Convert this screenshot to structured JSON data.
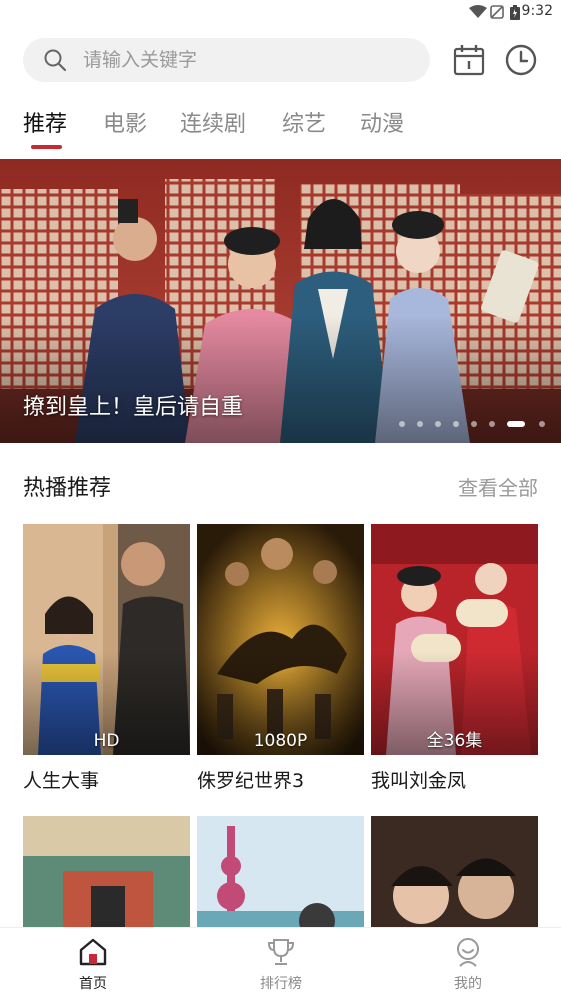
{
  "status_bar": {
    "time": "9:32"
  },
  "search": {
    "placeholder": "请输入关键字"
  },
  "header_icons": [
    "calendar-icon",
    "clock-icon"
  ],
  "tabs": [
    {
      "label": "推荐",
      "active": true
    },
    {
      "label": "电影",
      "active": false
    },
    {
      "label": "连续剧",
      "active": false
    },
    {
      "label": "综艺",
      "active": false
    },
    {
      "label": "动漫",
      "active": false
    }
  ],
  "banner": {
    "title": "撩到皇上！皇后请自重",
    "slide_count": 8,
    "active_slide": 7
  },
  "section": {
    "title": "热播推荐",
    "view_all": "查看全部"
  },
  "cards": [
    {
      "title": "人生大事",
      "badge": "HD"
    },
    {
      "title": "侏罗纪世界3",
      "badge": "1080P"
    },
    {
      "title": "我叫刘金凤",
      "badge": "全36集"
    }
  ],
  "bottom_nav": [
    {
      "label": "首页",
      "icon": "home-icon",
      "active": true
    },
    {
      "label": "排行榜",
      "icon": "trophy-icon",
      "active": false
    },
    {
      "label": "我的",
      "icon": "profile-icon",
      "active": false
    }
  ],
  "colors": {
    "accent": "#c72a34",
    "active_text": "#111111",
    "inactive_text": "#8a8a8a",
    "search_bg": "#f1f1f1"
  }
}
